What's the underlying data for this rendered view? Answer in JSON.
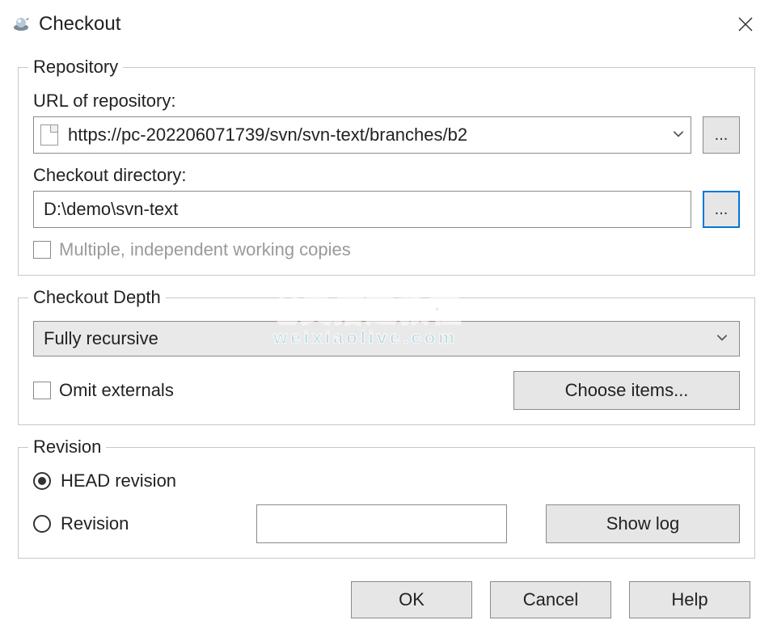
{
  "window": {
    "title": "Checkout"
  },
  "repository": {
    "legend": "Repository",
    "url_label": "URL of repository:",
    "url_value": "https://pc-202206071739/svn/svn-text/branches/b2",
    "dir_label": "Checkout directory:",
    "dir_value": "D:\\demo\\svn-text",
    "browse": "...",
    "multiple_label": "Multiple, independent working copies"
  },
  "depth": {
    "legend": "Checkout Depth",
    "selected": "Fully recursive",
    "omit_label": "Omit externals",
    "choose_items": "Choose items..."
  },
  "revision": {
    "legend": "Revision",
    "head_label": "HEAD revision",
    "rev_label": "Revision",
    "rev_value": "",
    "show_log": "Show log"
  },
  "buttons": {
    "ok": "OK",
    "cancel": "Cancel",
    "help": "Help"
  },
  "watermark": {
    "main": "老吴搭建教程",
    "sub": "weixiaolive.com"
  }
}
